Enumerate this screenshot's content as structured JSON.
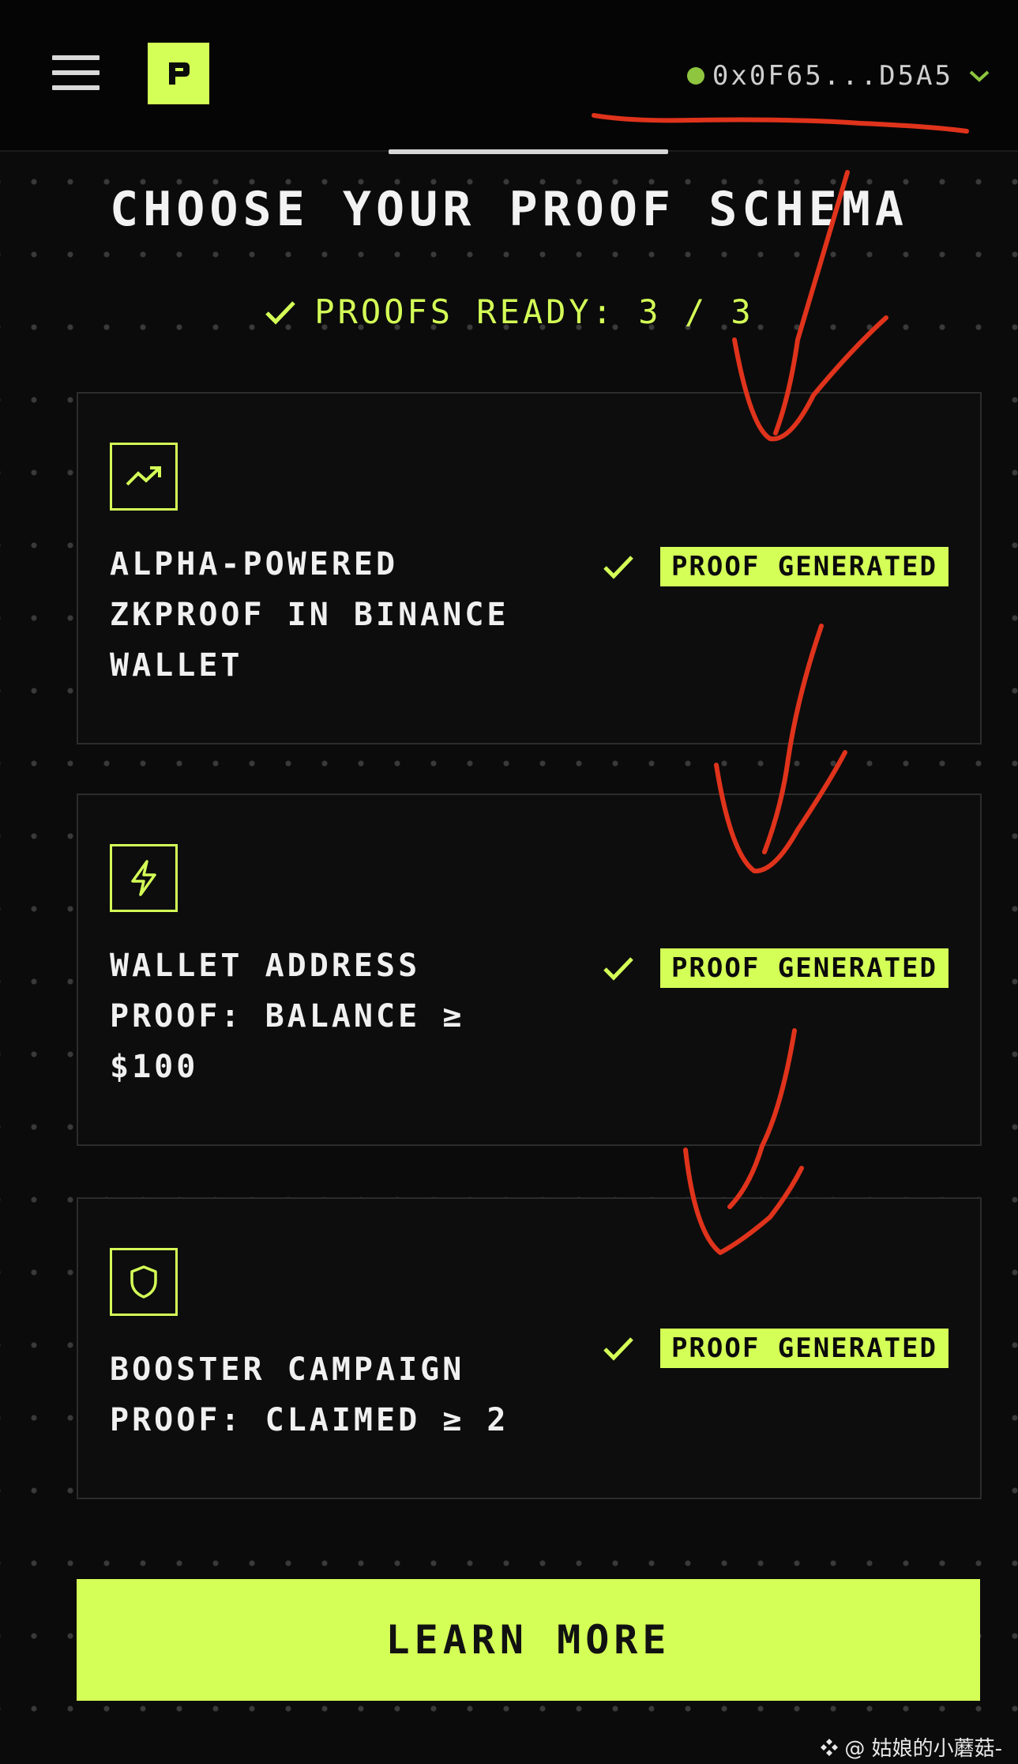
{
  "header": {
    "logo_letter": "P",
    "wallet_address": "0x0F65...D5A5",
    "wallet_status_color": "#8ec63f"
  },
  "page": {
    "title": "CHOOSE YOUR PROOF SCHEMA",
    "proofs_ready": "PROOFS READY: 3 / 3"
  },
  "cards": [
    {
      "icon": "trending-up-icon",
      "title": "ALPHA-POWERED\nZKPROOF IN BINANCE\nWALLET",
      "status": "PROOF GENERATED"
    },
    {
      "icon": "lightning-icon",
      "title": "WALLET ADDRESS\nPROOF: BALANCE ≥\n$100",
      "status": "PROOF GENERATED"
    },
    {
      "icon": "shield-icon",
      "title": "BOOSTER CAMPAIGN\nPROOF: CLAIMED ≥ 2",
      "status": "PROOF GENERATED"
    }
  ],
  "cta": {
    "label": "LEARN MORE"
  },
  "watermark": {
    "text": "@   姑娘的小蘑菇-"
  },
  "colors": {
    "accent": "#d4ff57",
    "background": "#0b0b0b",
    "annotation": "#e0331c"
  }
}
